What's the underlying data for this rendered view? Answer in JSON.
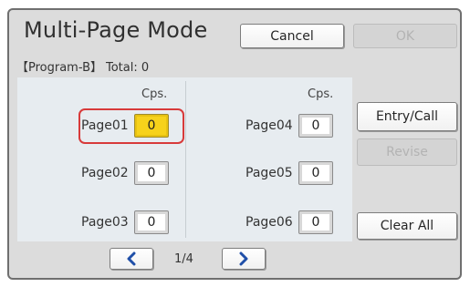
{
  "title": "Multi-Page Mode",
  "toolbar": {
    "cancel_label": "Cancel",
    "ok_label": "OK"
  },
  "program": {
    "name": "【Program-B】",
    "total_label": "Total: 0"
  },
  "columns": {
    "left_header": "Cps.",
    "right_header": "Cps."
  },
  "pages": [
    {
      "label": "Page01",
      "value": "0",
      "selected": true
    },
    {
      "label": "Page02",
      "value": "0"
    },
    {
      "label": "Page03",
      "value": "0"
    },
    {
      "label": "Page04",
      "value": "0"
    },
    {
      "label": "Page05",
      "value": "0"
    },
    {
      "label": "Page06",
      "value": "0"
    }
  ],
  "side_buttons": {
    "entry_call_label": "Entry/Call",
    "revise_label": "Revise",
    "clear_all_label": "Clear All"
  },
  "pagination": {
    "indicator": "1/4",
    "prev_icon": "chevron-left-icon",
    "next_icon": "chevron-right-icon"
  },
  "colors": {
    "accent_selected": "#f7d21b",
    "highlight_border": "#d83a3a",
    "nav_arrow": "#1f4fa8"
  }
}
